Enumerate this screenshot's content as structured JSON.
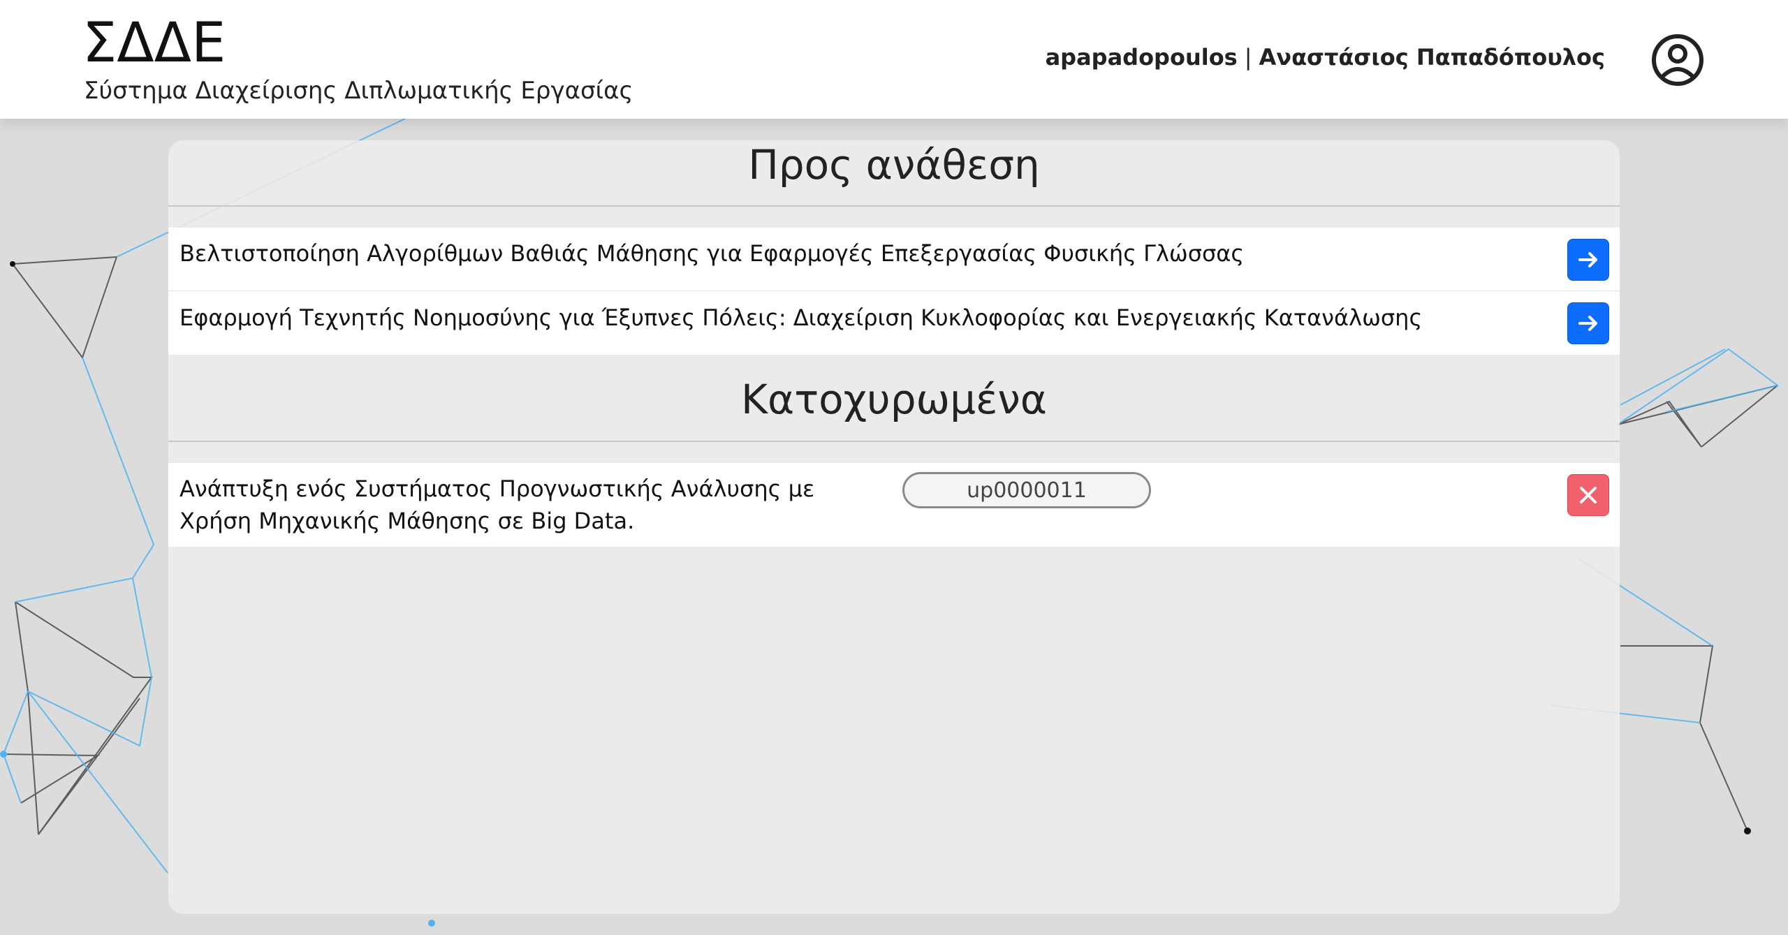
{
  "header": {
    "app_title": "ΣΔΔΕ",
    "app_subtitle": "Σύστημα Διαχείρισης Διπλωματικής Εργασίας",
    "username": "apapadopoulos",
    "separator": "|",
    "full_name": "Αναστάσιος Παπαδόπουλος",
    "account_icon": "account-circle-icon"
  },
  "sections": {
    "to_assign": {
      "title": "Προς ανάθεση",
      "items": [
        {
          "title": "Βελτιστοποίηση Αλγορίθμων Βαθιάς Μάθησης για Εφαρμογές Επεξεργασίας Φυσικής Γλώσσας",
          "action_icon": "arrow-right-icon"
        },
        {
          "title": "Εφαρμογή Τεχνητής Νοημοσύνης για Έξυπνες Πόλεις: Διαχείριση Κυκλοφορίας και Ενεργειακής Κατανάλωσης",
          "action_icon": "arrow-right-icon"
        }
      ]
    },
    "registered": {
      "title": "Κατοχυρωμένα",
      "items": [
        {
          "title": "Ανάπτυξη ενός Συστήματος Προγνωστικής Ανάλυσης με Χρήση Μηχανικής Μάθησης σε Big Data.",
          "student_id": "up0000011",
          "action_icon": "close-icon"
        }
      ]
    }
  },
  "colors": {
    "primary_button": "#0d6efd",
    "danger_button": "#f0616b",
    "network_blue": "#4fb3f0",
    "network_dark": "#333333"
  }
}
